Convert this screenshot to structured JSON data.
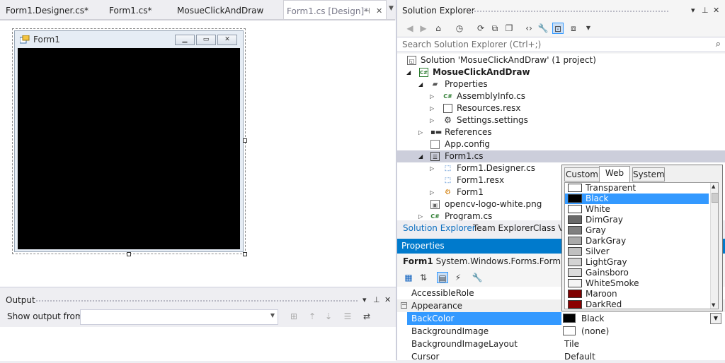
{
  "doc_tabs": [
    {
      "label": "Form1.Designer.cs*"
    },
    {
      "label": "Form1.cs*"
    },
    {
      "label": "MosueClickAndDraw"
    },
    {
      "label": "Form1.cs [Design]*"
    }
  ],
  "designer": {
    "form_title": "Form1",
    "client_color": "#000000"
  },
  "output": {
    "title": "Output",
    "show_output_label": "Show output from:",
    "show_output_value": ""
  },
  "solution_explorer": {
    "title": "Solution Explorer",
    "search_placeholder": "Search Solution Explorer (Ctrl+;)",
    "tree": [
      {
        "label": "Solution 'MosueClickAndDraw' (1 project)",
        "icon": "solution-icon"
      },
      {
        "label": "MosueClickAndDraw",
        "icon": "csharp-project-icon",
        "bold": true
      },
      {
        "label": "Properties",
        "icon": "properties-folder-icon"
      },
      {
        "label": "AssemblyInfo.cs",
        "icon": "csharp-file-icon"
      },
      {
        "label": "Resources.resx",
        "icon": "resx-file-icon"
      },
      {
        "label": "Settings.settings",
        "icon": "settings-gear-icon"
      },
      {
        "label": "References",
        "icon": "references-icon"
      },
      {
        "label": "App.config",
        "icon": "config-file-icon"
      },
      {
        "label": "Form1.cs",
        "icon": "form-file-icon",
        "selected": true
      },
      {
        "label": "Form1.Designer.cs",
        "icon": "csharp-designer-icon"
      },
      {
        "label": "Form1.resx",
        "icon": "resx-file-icon"
      },
      {
        "label": "Form1",
        "icon": "class-icon"
      },
      {
        "label": "opencv-logo-white.png",
        "icon": "image-file-icon"
      },
      {
        "label": "Program.cs",
        "icon": "csharp-file-icon"
      }
    ],
    "bottom_tabs": [
      {
        "label": "Solution Explorer",
        "active": true
      },
      {
        "label": "Team Explorer"
      },
      {
        "label": "Class Vi"
      }
    ]
  },
  "properties": {
    "title": "Properties",
    "object_name": "Form1",
    "object_type": "System.Windows.Forms.Form",
    "rows": [
      {
        "name": "AccessibleRole",
        "value": ""
      },
      {
        "name": "Appearance",
        "value": "",
        "category": true
      },
      {
        "name": "BackColor",
        "value": "Black",
        "selected": true
      },
      {
        "name": "BackgroundImage",
        "value": "(none)"
      },
      {
        "name": "BackgroundImageLayout",
        "value": "Tile"
      },
      {
        "name": "Cursor",
        "value": "Default"
      }
    ]
  },
  "color_picker": {
    "tabs": [
      "Custom",
      "Web",
      "System"
    ],
    "active_tab": "Web",
    "colors": [
      {
        "name": "Transparent",
        "hex": "#ffffff"
      },
      {
        "name": "Black",
        "hex": "#000000",
        "selected": true
      },
      {
        "name": "White",
        "hex": "#ffffff"
      },
      {
        "name": "DimGray",
        "hex": "#696969"
      },
      {
        "name": "Gray",
        "hex": "#808080"
      },
      {
        "name": "DarkGray",
        "hex": "#a9a9a9"
      },
      {
        "name": "Silver",
        "hex": "#c0c0c0"
      },
      {
        "name": "LightGray",
        "hex": "#d3d3d3"
      },
      {
        "name": "Gainsboro",
        "hex": "#dcdcdc"
      },
      {
        "name": "WhiteSmoke",
        "hex": "#f5f5f5"
      },
      {
        "name": "Maroon",
        "hex": "#800000"
      },
      {
        "name": "DarkRed",
        "hex": "#8b0000"
      }
    ]
  }
}
